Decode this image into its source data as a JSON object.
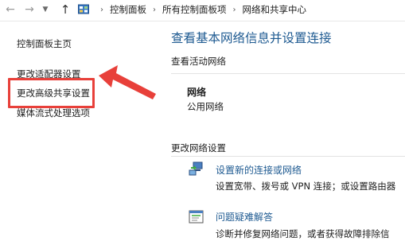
{
  "address_bar": {
    "breadcrumbs": [
      "控制面板",
      "所有控制面板项",
      "网络和共享中心"
    ]
  },
  "sidebar": {
    "items": [
      {
        "label": "控制面板主页"
      },
      {
        "label": "更改适配器设置"
      },
      {
        "label": "更改高级共享设置"
      },
      {
        "label": "媒体流式处理选项"
      }
    ]
  },
  "main": {
    "title": "查看基本网络信息并设置连接",
    "active_networks_label": "查看活动网络",
    "network": {
      "name": "网络",
      "type": "公用网络"
    },
    "change_settings_label": "更改网络设置",
    "tasks": [
      {
        "title": "设置新的连接或网络",
        "description": "设置宽带、拨号或 VPN 连接；或设置路由器"
      },
      {
        "title": "问题疑难解答",
        "description": "诊断并修复网络问题，或者获得故障排除信"
      }
    ]
  },
  "colors": {
    "link_blue": "#1e5a91",
    "annotation_red": "#e8403a"
  }
}
